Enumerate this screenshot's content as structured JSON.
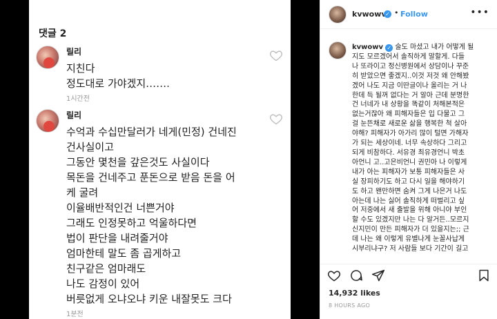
{
  "comments_screenshot": {
    "header": "댓글 2",
    "comments": [
      {
        "name": "릴리",
        "lines": [
          "지친다",
          "정도대로 가야겠지……."
        ],
        "time": "1시간전"
      },
      {
        "name": "릴리",
        "lines": [
          "수억과 수십만달러가 네게(민정) 건네진",
          "건사실이고",
          "그동안 몇천을 갚은것도 사실이다",
          "목돈을 건네주고 푼돈으로 받음 돈을 어",
          "케 굴려",
          "이율배반적인건 너쁜거야",
          "그래도 인정못하고 억울하다면",
          "법이 판단을 내려줄거야",
          "엄마한테 말도 좀 곱게하고",
          "친구같은 엄마래도",
          "나도 감정이 있어",
          "버릇없게 오냐오냐 키운 내잘못도 크다"
        ],
        "time": "1분전"
      }
    ]
  },
  "post": {
    "username": "kvwowv",
    "verified_icon": "verified-badge-icon",
    "follow_label": "Follow",
    "more_label": "•••",
    "caption_lines": [
      "술도 마셨고 내가 어떻게 될",
      "지도 모르겠어서 솔직하게 말할게. 다들",
      "나 또라이고 정신병원에서 상담이나 꾸준",
      "히 받았으면 좋겠지..이것 저것 왜 안해봤",
      "겠어 나도 지금 이딴글이나 올리는 거 나",
      "한데 득 될꺼 없다는 거 알아 근데 분명한",
      "건 너네가 내 상황을 똑같이 처해본적은",
      "없는거잖아 왜 피해자들은 입 다물고 그",
      "걸 눈뜬채로 새로운 삶을 행복한 척 살아",
      "야해? 피해자가 아가리 많이 털면 가해자",
      "가 되는 세상이네. 너무 속상하다 그리고",
      "되게 비참하다. 서유경 최유경언니 박초",
      "아언니 고..고은비언니 권민아 나 이렇게",
      "내가 아는 피해자가 보통 피해자들은 사",
      "실 장피하기도 하고 다시 일을 해야하기",
      "도 하고 왠만하면 숨켜 그게 나은거 나도",
      "아는데 나는 싫어 솔직하게 떠벌리고 싶",
      "어 저중에서 새 출발을 위해 아니야 부인",
      "할 수도 있겠지만 나는 다 알거든..모르지",
      "신지민이 만든 피해자가 더 있을지는;; 근",
      "데 나는 왜 이렇게 유별나게 눈꼴사납게",
      "시부리냐구? 저 사람들 보다 기간이 길고"
    ],
    "likes": "14,932 likes",
    "time_ago": "8 HOURS AGO",
    "colors": {
      "link": "#3897f0",
      "text": "#262626",
      "muted": "#999999",
      "border": "#efefef"
    }
  }
}
